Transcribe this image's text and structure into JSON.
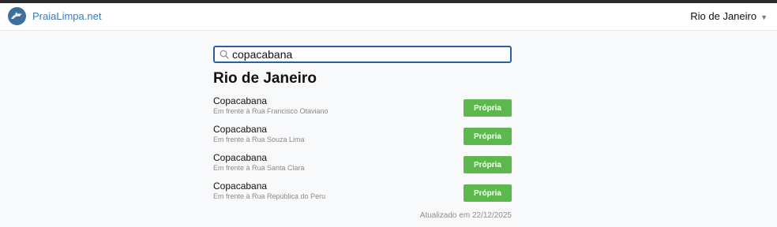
{
  "header": {
    "brand": "PraiaLimpa.net",
    "logo_icon": "dolphin-icon",
    "city_selector": {
      "label": "Rio de Janeiro",
      "caret_icon": "caret-down-icon"
    }
  },
  "search": {
    "icon": "search-icon",
    "value": "copacabana"
  },
  "main": {
    "city_title": "Rio de Janeiro",
    "beaches": [
      {
        "name": "Copacabana",
        "location": "Em frente à Rua Francisco Otaviano",
        "status": "Própria"
      },
      {
        "name": "Copacabana",
        "location": "Em frente à Rua Souza Lima",
        "status": "Própria"
      },
      {
        "name": "Copacabana",
        "location": "Em frente à Rua Santa Clara",
        "status": "Própria"
      },
      {
        "name": "Copacabana",
        "location": "Em frente à Rua República do Peru",
        "status": "Própria"
      }
    ],
    "updated": "Atualizado em 22/12/2025"
  },
  "colors": {
    "brand": "#3a7bb8",
    "status_ok": "#5cb84c",
    "search_border": "#2c5f9e"
  }
}
